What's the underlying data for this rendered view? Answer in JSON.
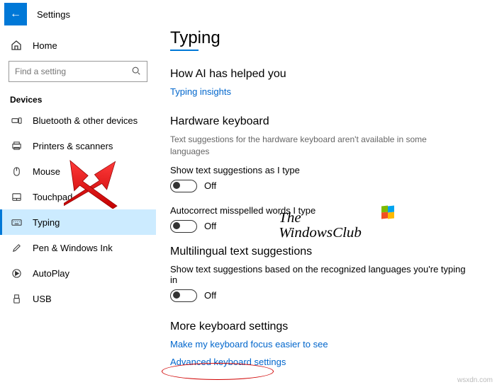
{
  "header": {
    "title": "Settings"
  },
  "sidebar": {
    "home": "Home",
    "search_placeholder": "Find a setting",
    "section": "Devices",
    "items": [
      {
        "label": "Bluetooth & other devices",
        "selected": false
      },
      {
        "label": "Printers & scanners",
        "selected": false
      },
      {
        "label": "Mouse",
        "selected": false
      },
      {
        "label": "Touchpad",
        "selected": false
      },
      {
        "label": "Typing",
        "selected": true
      },
      {
        "label": "Pen & Windows Ink",
        "selected": false
      },
      {
        "label": "AutoPlay",
        "selected": false
      },
      {
        "label": "USB",
        "selected": false
      }
    ]
  },
  "content": {
    "page_title": "Typing",
    "section1": {
      "heading": "How AI has helped you",
      "link": "Typing insights"
    },
    "section2": {
      "heading": "Hardware keyboard",
      "note": "Text suggestions for the hardware keyboard aren't available in some languages",
      "setting1_label": "Show text suggestions as I type",
      "setting1_state": "Off",
      "setting2_label": "Autocorrect misspelled words I type",
      "setting2_state": "Off"
    },
    "section3": {
      "heading": "Multilingual text suggestions",
      "setting_label": "Show text suggestions based on the recognized languages you're typing in",
      "setting_state": "Off"
    },
    "section4": {
      "heading": "More keyboard settings",
      "link1": "Make my keyboard focus easier to see",
      "link2": "Advanced keyboard settings"
    }
  },
  "watermark": {
    "line1": "The",
    "line2": "WindowsClub"
  },
  "source_mark": "wsxdn.com"
}
